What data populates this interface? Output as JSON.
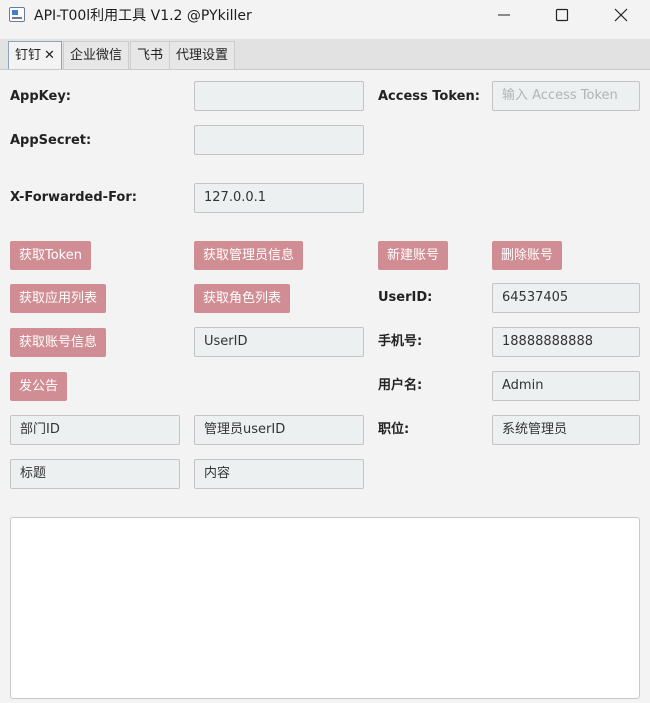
{
  "window": {
    "title": "API-T00l利用工具 V1.2 @PYkiller",
    "app_icon": "app-window-icon",
    "controls": [
      "minimize-icon",
      "maximize-icon",
      "close-icon"
    ]
  },
  "tabs": [
    {
      "label": "钉钉",
      "closable": true,
      "close_glyph": "✕",
      "active": true
    },
    {
      "label": "企业微信"
    },
    {
      "label": "飞书"
    },
    {
      "label": "代理设置"
    }
  ],
  "form": {
    "appkey_label": "AppKey:",
    "appkey_value": "",
    "access_token_label": "Access Token:",
    "access_token_placeholder": "输入 Access Token",
    "appsecret_label": "AppSecret:",
    "appsecret_value": "",
    "xff_label": "X-Forwarded-For:",
    "xff_value": "127.0.0.1"
  },
  "buttons": {
    "get_token": "获取Token",
    "get_admin_info": "获取管理员信息",
    "new_account": "新建账号",
    "delete_account": "删除账号",
    "get_app_list": "获取应用列表",
    "get_role_list": "获取角色列表",
    "get_account_info": "获取账号信息",
    "post_announcement": "发公告"
  },
  "account": {
    "userid_label": "UserID:",
    "userid_value": "64537405",
    "userid_query_value": "UserID",
    "phone_label": "手机号:",
    "phone_value": "18888888888",
    "username_label": "用户名:",
    "username_value": "Admin",
    "position_label": "职位:",
    "position_value": "系统管理员"
  },
  "announcement": {
    "dept_id_value": "部门ID",
    "admin_userid_value": "管理员userID",
    "title_value": "标题",
    "content_value": "内容"
  },
  "output": {
    "text": ""
  },
  "colors": {
    "button_bg": "#d18d94",
    "field_bg": "#ecf0f1",
    "window_bg": "#f3f3f3"
  }
}
